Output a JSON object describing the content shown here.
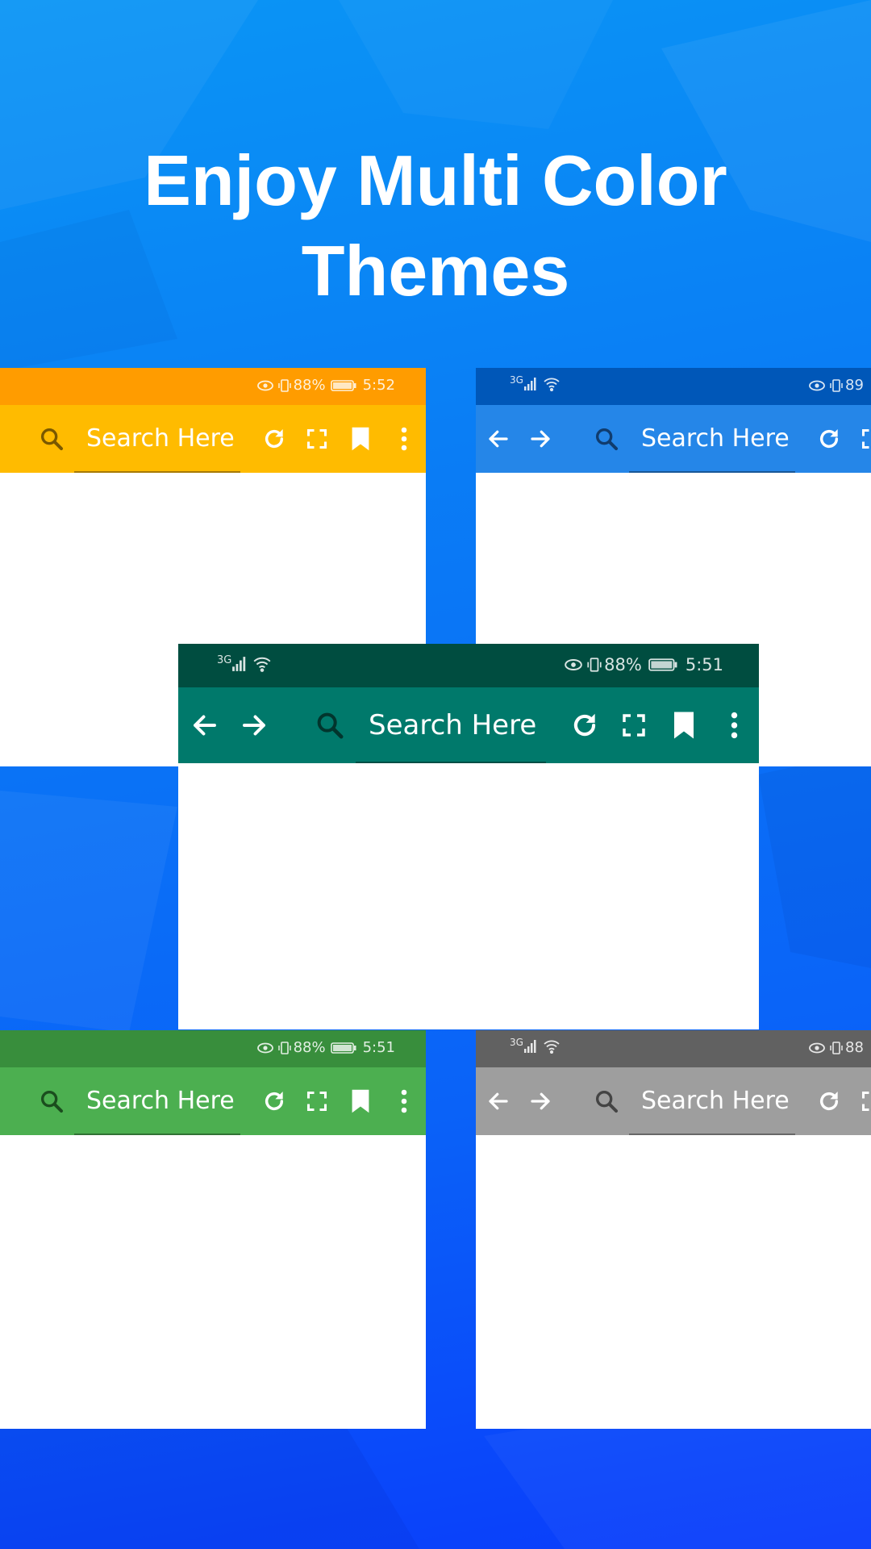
{
  "headline": {
    "line1": "Enjoy Multi Color",
    "line2": "Themes"
  },
  "search_placeholder": "Search Here",
  "icons": [
    "search-icon",
    "refresh-icon",
    "fullscreen-icon",
    "bookmark-icon",
    "more-vert-icon",
    "back-arrow-icon",
    "forward-arrow-icon",
    "eye-icon",
    "vibrate-icon",
    "battery-icon",
    "signal-icon",
    "wifi-icon"
  ],
  "themes": {
    "orange": {
      "status_color": "#ff9c00",
      "toolbar_color": "#ffbb00",
      "battery": "88%",
      "time": "5:52"
    },
    "blue": {
      "status_color": "#0057b8",
      "toolbar_color": "#2586e8",
      "network": "3G",
      "battery": "89"
    },
    "teal": {
      "status_color": "#004d40",
      "toolbar_color": "#00796b",
      "network": "3G",
      "battery": "88%",
      "time": "5:51"
    },
    "green": {
      "status_color": "#388e3c",
      "toolbar_color": "#4caf50",
      "battery": "88%",
      "time": "5:51"
    },
    "grey": {
      "status_color": "#616161",
      "toolbar_color": "#9e9e9e",
      "network": "3G",
      "battery": "88"
    }
  }
}
